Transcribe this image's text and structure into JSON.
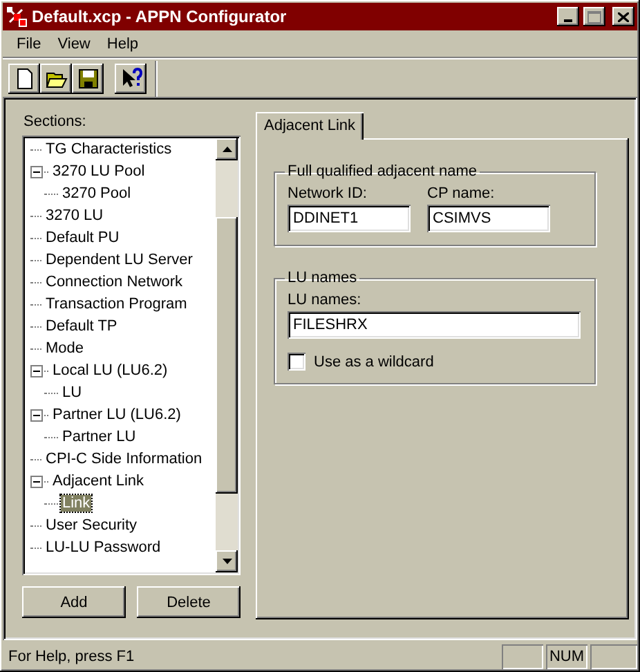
{
  "window": {
    "title": "Default.xcp - APPN Configurator"
  },
  "menu": [
    "File",
    "View",
    "Help"
  ],
  "sections": {
    "label": "Sections:",
    "items": [
      {
        "label": "TG Characteristics",
        "selected": false
      },
      {
        "label": "3270 LU Pool",
        "selected": false,
        "expanded": true,
        "children": [
          {
            "label": "3270 Pool",
            "selected": false
          }
        ]
      },
      {
        "label": "3270 LU",
        "selected": false
      },
      {
        "label": "Default PU",
        "selected": false
      },
      {
        "label": "Dependent LU Server",
        "selected": false
      },
      {
        "label": "Connection Network",
        "selected": false
      },
      {
        "label": "Transaction Program",
        "selected": false
      },
      {
        "label": "Default TP",
        "selected": false
      },
      {
        "label": "Mode",
        "selected": false
      },
      {
        "label": "Local LU (LU6.2)",
        "selected": false,
        "expanded": true,
        "children": [
          {
            "label": "LU",
            "selected": false
          }
        ]
      },
      {
        "label": "Partner LU (LU6.2)",
        "selected": false,
        "expanded": true,
        "children": [
          {
            "label": "Partner LU",
            "selected": false
          }
        ]
      },
      {
        "label": "CPI-C Side Information",
        "selected": false
      },
      {
        "label": "Adjacent Link",
        "selected": false,
        "expanded": true,
        "children": [
          {
            "label": "Link",
            "selected": true
          }
        ]
      },
      {
        "label": "User Security",
        "selected": false
      },
      {
        "label": "LU-LU Password",
        "selected": false
      }
    ],
    "buttons": [
      "Add",
      "Delete"
    ]
  },
  "tabs": [
    {
      "label": "Adjacent Link",
      "selected": true
    }
  ],
  "adjacent_name": {
    "title": "Full qualified adjacent name",
    "network_id": {
      "label": "Network ID:",
      "value": "DDINET1"
    },
    "cp_name": {
      "label": "CP name:",
      "value": "CSIMVS"
    }
  },
  "lu_names": {
    "title": "LU names",
    "field": {
      "label": "LU names:",
      "value": "FILESHRX"
    },
    "wildcard": {
      "label": "Use as a wildcard",
      "checked": false
    }
  },
  "status_bar": {
    "text": "For Help, press F1",
    "panels": [
      "NUM"
    ]
  }
}
